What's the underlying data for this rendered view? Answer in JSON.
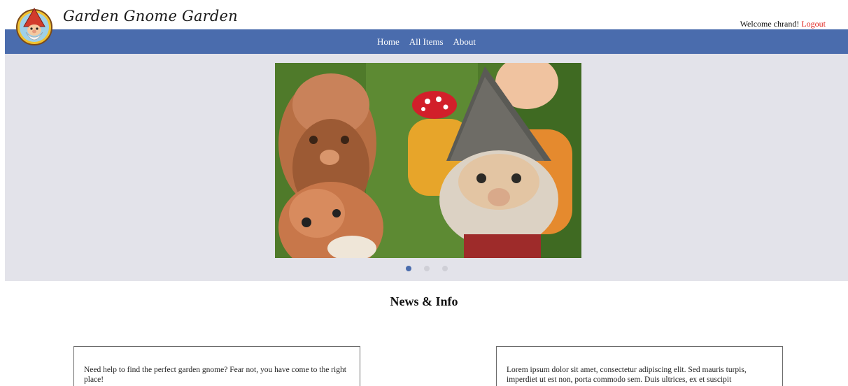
{
  "header": {
    "brand": "Garden Gnome Garden",
    "welcome_text": "Welcome chrand!",
    "logout_label": "Logout"
  },
  "nav": {
    "items": [
      {
        "label": "Home"
      },
      {
        "label": "All Items"
      },
      {
        "label": "About"
      }
    ]
  },
  "carousel": {
    "slide_count": 3,
    "active_index": 0,
    "accent_color": "#4a6cad"
  },
  "news": {
    "title": "News & Info",
    "cards": [
      {
        "text": "Need help to find the perfect garden gnome? Fear not, you have come to the right place!"
      },
      {
        "text": "Lorem ipsum dolor sit amet, consectetur adipiscing elit. Sed mauris turpis, imperdiet ut est non, porta commodo sem. Duis ultrices, ex et suscipit"
      }
    ]
  },
  "colors": {
    "nav_bg": "#4a6cad",
    "carousel_bg": "#e3e3ea",
    "logout": "#e0201b"
  }
}
